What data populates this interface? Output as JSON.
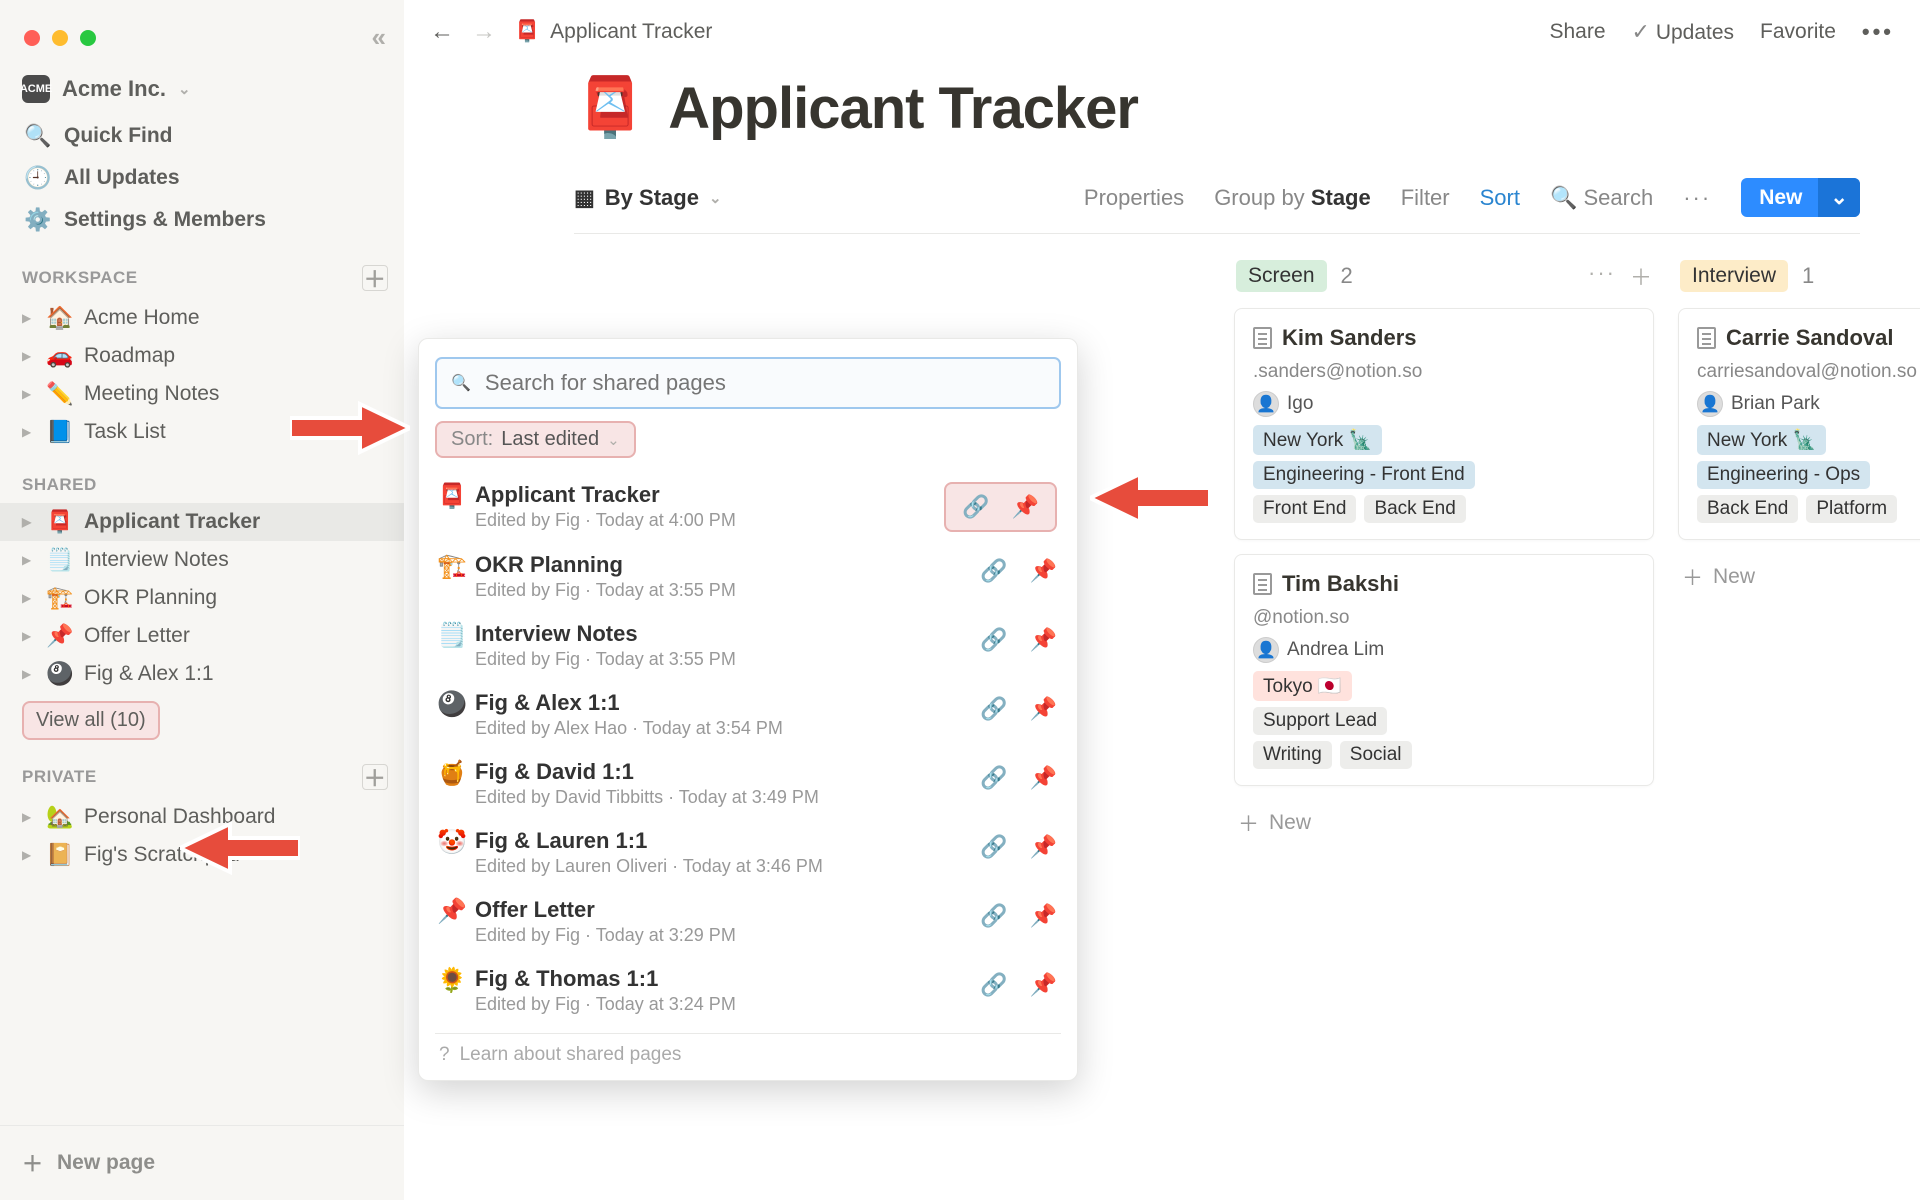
{
  "window": {
    "workspace": "Acme Inc."
  },
  "sidebar": {
    "quickFind": "Quick Find",
    "allUpdates": "All Updates",
    "settings": "Settings & Members",
    "sections": {
      "workspace": "WORKSPACE",
      "shared": "SHARED",
      "private": "PRIVATE"
    },
    "workspaceItems": [
      {
        "emoji": "🏠",
        "label": "Acme Home"
      },
      {
        "emoji": "🚗",
        "label": "Roadmap"
      },
      {
        "emoji": "✏️",
        "label": "Meeting Notes"
      },
      {
        "emoji": "📘",
        "label": "Task List"
      }
    ],
    "sharedItems": [
      {
        "emoji": "📮",
        "label": "Applicant Tracker",
        "active": true
      },
      {
        "emoji": "🗒️",
        "label": "Interview Notes"
      },
      {
        "emoji": "🏗️",
        "label": "OKR Planning"
      },
      {
        "emoji": "📌",
        "label": "Offer Letter"
      },
      {
        "emoji": "🎱",
        "label": "Fig & Alex 1:1"
      }
    ],
    "viewAll": "View all (10)",
    "privateItems": [
      {
        "emoji": "🏡",
        "label": "Personal Dashboard"
      },
      {
        "emoji": "📔",
        "label": "Fig's Scratchpad"
      }
    ],
    "newPage": "New page"
  },
  "topbar": {
    "title": "Applicant Tracker",
    "share": "Share",
    "updates": "Updates",
    "favorite": "Favorite"
  },
  "page": {
    "icon": "📮",
    "title": "Applicant Tracker",
    "view": "By Stage",
    "properties": "Properties",
    "groupBy": "Group by",
    "groupField": "Stage",
    "filter": "Filter",
    "sort": "Sort",
    "search": "Search",
    "newBtn": "New"
  },
  "columns": [
    {
      "name": "Screen",
      "color": "#d7eedc",
      "count": 2,
      "showActions": true
    },
    {
      "name": "Interview",
      "color": "#fdecc8",
      "count": 1
    }
  ],
  "cards": {
    "c0": {
      "name": "Kim Sanders",
      "email": ".sanders@notion.so",
      "who": "Igo",
      "whoFull": "lgo",
      "loc": "New York 🗽",
      "locColor": "#d3e5ef",
      "dept": "Engineering - Front End",
      "deptColor": "#d3e5ef",
      "skills": [
        {
          "t": "Front End",
          "c": "#ededeb"
        },
        {
          "t": "Back End",
          "c": "#ededeb"
        }
      ]
    },
    "c1": {
      "name": "Tim Bakshi",
      "email": "@notion.so",
      "who": "Andrea Lim",
      "loc": "Tokyo  🇯🇵",
      "locColor": "#ffe2dd",
      "dept": "Support Lead",
      "deptColor": "#ededeb",
      "skills": [
        {
          "t": "Writing",
          "c": "#ededeb"
        },
        {
          "t": "Social",
          "c": "#ededeb"
        }
      ]
    },
    "c2": {
      "name": "Carrie Sandoval",
      "email": "carriesandoval@notion.so",
      "who": "Brian Park",
      "loc": "New York 🗽",
      "locColor": "#d3e5ef",
      "dept": "Engineering - Ops",
      "deptColor": "#d3e5ef",
      "skills": [
        {
          "t": "Back End",
          "c": "#ededeb"
        },
        {
          "t": "Platform",
          "c": "#ededeb"
        }
      ]
    }
  },
  "newRow": "New",
  "popover": {
    "placeholder": "Search for shared pages",
    "sortLabel": "Sort:",
    "sortValue": "Last edited",
    "learn": "Learn about shared pages",
    "items": [
      {
        "icon": "📮",
        "title": "Applicant Tracker",
        "sub": "Edited by Fig · Today at 4:00 PM"
      },
      {
        "icon": "🏗️",
        "title": "OKR Planning",
        "sub": "Edited by Fig · Today at 3:55 PM"
      },
      {
        "icon": "🗒️",
        "title": "Interview Notes",
        "sub": "Edited by Fig · Today at 3:55 PM"
      },
      {
        "icon": "🎱",
        "title": "Fig & Alex 1:1",
        "sub": "Edited by Alex Hao · Today at 3:54 PM"
      },
      {
        "icon": "🍯",
        "title": "Fig & David 1:1",
        "sub": "Edited by David Tibbitts · Today at 3:49 PM"
      },
      {
        "icon": "🤡",
        "title": "Fig & Lauren 1:1",
        "sub": "Edited by Lauren Oliveri · Today at 3:46 PM"
      },
      {
        "icon": "📌",
        "title": "Offer Letter",
        "sub": "Edited by Fig · Today at 3:29 PM"
      },
      {
        "icon": "🌻",
        "title": "Fig & Thomas 1:1",
        "sub": "Edited by Fig · Today at 3:24 PM"
      }
    ]
  }
}
